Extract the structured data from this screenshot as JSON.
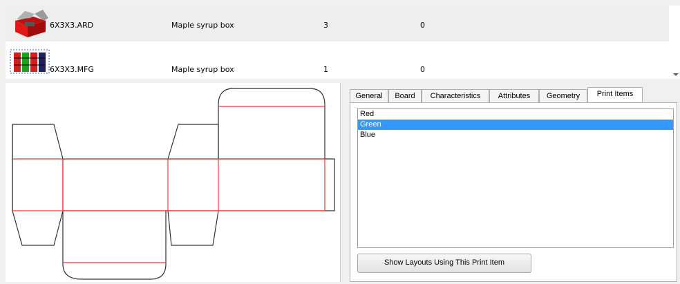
{
  "files": [
    {
      "name": "6X3X3.ARD",
      "description": "Maple syrup box",
      "qty": "3",
      "value": "0",
      "thumb_icon": "open-box-icon"
    },
    {
      "name": "6X3X3.MFG",
      "description": "Maple syrup box",
      "qty": "1",
      "value": "0",
      "thumb_icon": "layout-pattern-icon"
    }
  ],
  "tabs": [
    {
      "label": "General"
    },
    {
      "label": "Board"
    },
    {
      "label": "Characteristics"
    },
    {
      "label": "Attributes"
    },
    {
      "label": "Geometry"
    },
    {
      "label": "Print Items"
    }
  ],
  "active_tab": "Print Items",
  "print_items": {
    "items": [
      "Red",
      "Green",
      "Blue"
    ],
    "selected": "Green",
    "button_label": "Show Layouts Using This Print Item"
  },
  "colors": {
    "cut_line": "#303030",
    "crease_line": "#ff3333",
    "selection": "#3399ff"
  }
}
